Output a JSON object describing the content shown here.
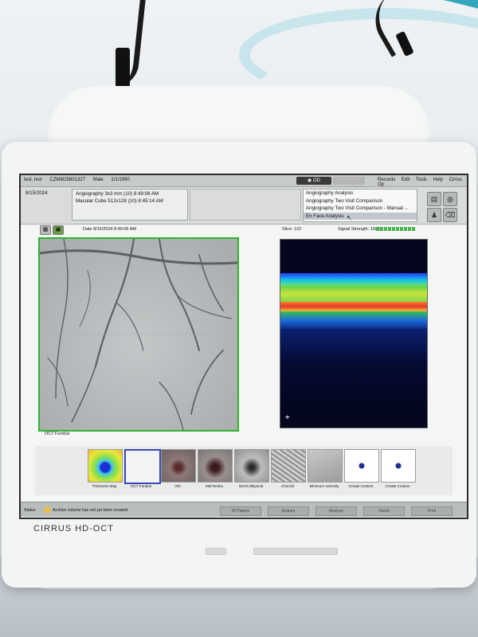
{
  "patient": {
    "name": "test, test",
    "id": "CZMI825801327",
    "sex": "Male",
    "dob": "1/1/1990"
  },
  "eye_toggle": {
    "od": "OD"
  },
  "menu": [
    "Records",
    "Edit",
    "Tools",
    "Help",
    "Cirrus Op"
  ],
  "info": {
    "visit_date": "8/15/2024",
    "scans": [
      "Angiography 3x3 mm (10)  8:49:06 AM",
      "Macular Cube 512x128 (10)  8:45:14 AM"
    ],
    "analyses": [
      "Angiography Analysis",
      "Angiography Two Visit Comparison",
      "Angiography Two Visit Comparison - Manual ...",
      "En Face Analysis"
    ],
    "selected_analysis": "En Face Analysis"
  },
  "viewer": {
    "date_label": "Date 8/15/2024 8:49:06 AM",
    "slice_label": "Slice: 122",
    "signal_label": "Signal Strength: 10/10",
    "signal_strength": 10,
    "signal_max": 10,
    "fundus_caption": "OCT Fundus",
    "accent_green": "#2ab72a"
  },
  "thumbnails": [
    {
      "label": "Thickness Map",
      "selected": false,
      "kind": "thickness"
    },
    {
      "label": "OCT Fundus",
      "selected": true,
      "kind": "blank"
    },
    {
      "label": "VRI",
      "selected": false,
      "kind": "vri"
    },
    {
      "label": "Mid Retina",
      "selected": false,
      "kind": "midretina"
    },
    {
      "label": "IS/OS Ellipsoid",
      "selected": false,
      "kind": "ellipsoid"
    },
    {
      "label": "Choroid",
      "selected": false,
      "kind": "choroid"
    },
    {
      "label": "Minimum Intensity",
      "selected": false,
      "kind": "minint"
    },
    {
      "label": "Create Custom",
      "selected": false,
      "kind": "custom"
    },
    {
      "label": "Create Custom",
      "selected": false,
      "kind": "custom"
    }
  ],
  "status": {
    "label": "Status",
    "message": "Archive volume has not yet been created",
    "tabs": [
      "ID Patient",
      "Acquire",
      "Analyze",
      "Finish",
      "Print"
    ]
  },
  "device_brand": "CIRRUS HD-OCT"
}
